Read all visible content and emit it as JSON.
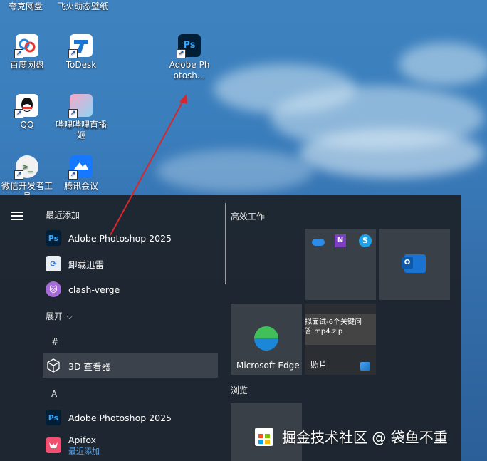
{
  "desktop": {
    "top_labels": [
      "夸克网盘",
      "飞火动态壁纸"
    ],
    "icons": [
      {
        "label": "百度网盘"
      },
      {
        "label": "ToDesk"
      },
      {
        "label": "Adobe Photosh..."
      },
      {
        "label": "QQ"
      },
      {
        "label": "哔哩哔哩直播姬"
      },
      {
        "label": "微信开发者工具"
      },
      {
        "label": "腾讯会议"
      }
    ]
  },
  "start_menu": {
    "recent_header": "最近添加",
    "recent_apps": [
      {
        "label": "Adobe Photoshop 2025",
        "icon": "photoshop-icon",
        "glyph": "Ps"
      },
      {
        "label": "卸载迅雷",
        "icon": "xunlei-uninstall-icon",
        "glyph": "⟳"
      },
      {
        "label": "clash-verge",
        "icon": "clash-verge-icon",
        "glyph": "🐱"
      }
    ],
    "expand_label": "展开",
    "expand_chevron": "⌵",
    "groups": [
      {
        "letter": "#",
        "apps": [
          {
            "label": "3D 查看器",
            "icon": "3d-viewer-icon"
          }
        ]
      },
      {
        "letter": "A",
        "apps": [
          {
            "label": "Adobe Photoshop 2025",
            "icon": "photoshop-icon",
            "glyph": "Ps"
          },
          {
            "label": "Apifox",
            "sublabel": "最近添加",
            "icon": "apifox-icon"
          }
        ]
      }
    ],
    "tile_groups": [
      {
        "title": "高效工作"
      },
      {
        "title": "浏览"
      }
    ],
    "tiles": {
      "office_group": {
        "icons": [
          "onedrive-icon",
          "onenote-icon",
          "skype-icon"
        ],
        "skype_glyph": "S",
        "onenote_glyph": "N"
      },
      "outlook": {
        "icon": "outlook-icon",
        "glyph": "O"
      },
      "edge": {
        "label": "Microsoft Edge",
        "icon": "edge-icon"
      },
      "photos": {
        "label": "照片",
        "preview_text": "拟面试-6个关键问答.mp4.zip",
        "icon": "photos-icon"
      },
      "store": {
        "icon": "store-icon"
      }
    }
  },
  "watermark": {
    "text": "掘金技术社区 @ 袋鱼不重"
  },
  "colors": {
    "accent": "#1e252d",
    "annotation_arrow": "#d9262a",
    "edge_blue": "#1c87d8",
    "photoshop_blue": "#31a8ff"
  }
}
